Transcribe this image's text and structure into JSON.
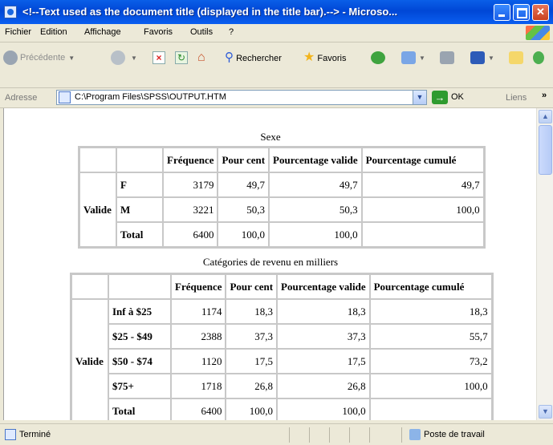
{
  "window": {
    "title": "<!--Text used as the document title (displayed in the title bar).--> - Microso..."
  },
  "menu": [
    "Fichier",
    "Edition",
    "Affichage",
    "Favoris",
    "Outils",
    "?"
  ],
  "toolbar": {
    "back_label": "Précédente",
    "search_label": "Rechercher",
    "favorites_label": "Favoris"
  },
  "address": {
    "label": "Adresse",
    "value": "C:\\Program Files\\SPSS\\OUTPUT.HTM",
    "go_label": "OK",
    "links_label": "Liens"
  },
  "tables": [
    {
      "caption": "Sexe",
      "headers": [
        "Fréquence",
        "Pour cent",
        "Pourcentage valide",
        "Pourcentage cumulé"
      ],
      "group_label": "Valide",
      "rows": [
        {
          "label": "F",
          "values": [
            "3179",
            "49,7",
            "49,7",
            "49,7"
          ]
        },
        {
          "label": "M",
          "values": [
            "3221",
            "50,3",
            "50,3",
            "100,0"
          ]
        },
        {
          "label": "Total",
          "values": [
            "6400",
            "100,0",
            "100,0",
            ""
          ]
        }
      ]
    },
    {
      "caption": "Catégories de revenu en milliers",
      "headers": [
        "Fréquence",
        "Pour cent",
        "Pourcentage valide",
        "Pourcentage cumulé"
      ],
      "group_label": "Valide",
      "rows": [
        {
          "label": "Inf à $25",
          "values": [
            "1174",
            "18,3",
            "18,3",
            "18,3"
          ]
        },
        {
          "label": "$25 - $49",
          "values": [
            "2388",
            "37,3",
            "37,3",
            "55,7"
          ]
        },
        {
          "label": "$50 - $74",
          "values": [
            "1120",
            "17,5",
            "17,5",
            "73,2"
          ]
        },
        {
          "label": "$75+",
          "values": [
            "1718",
            "26,8",
            "26,8",
            "100,0"
          ]
        },
        {
          "label": "Total",
          "values": [
            "6400",
            "100,0",
            "100,0",
            ""
          ]
        }
      ]
    }
  ],
  "status": {
    "text": "Terminé",
    "zone": "Poste de travail"
  }
}
